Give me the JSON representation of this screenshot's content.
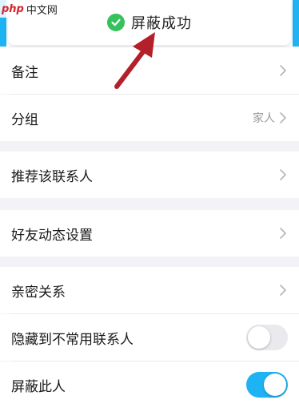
{
  "toast": {
    "text": "屏蔽成功"
  },
  "watermark": {
    "mark": "php",
    "text": "中文网"
  },
  "settings": {
    "remark": {
      "label": "备注"
    },
    "group": {
      "label": "分组",
      "value": "家人"
    },
    "recommend": {
      "label": "推荐该联系人"
    },
    "moments": {
      "label": "好友动态设置"
    },
    "intimacy": {
      "label": "亲密关系"
    },
    "hide_uncommon": {
      "label": "隐藏到不常用联系人",
      "enabled": false
    },
    "block": {
      "label": "屏蔽此人",
      "enabled": true
    }
  },
  "colors": {
    "accent": "#1eb3f3",
    "success": "#35c15c",
    "annotation": "#b3202a"
  }
}
